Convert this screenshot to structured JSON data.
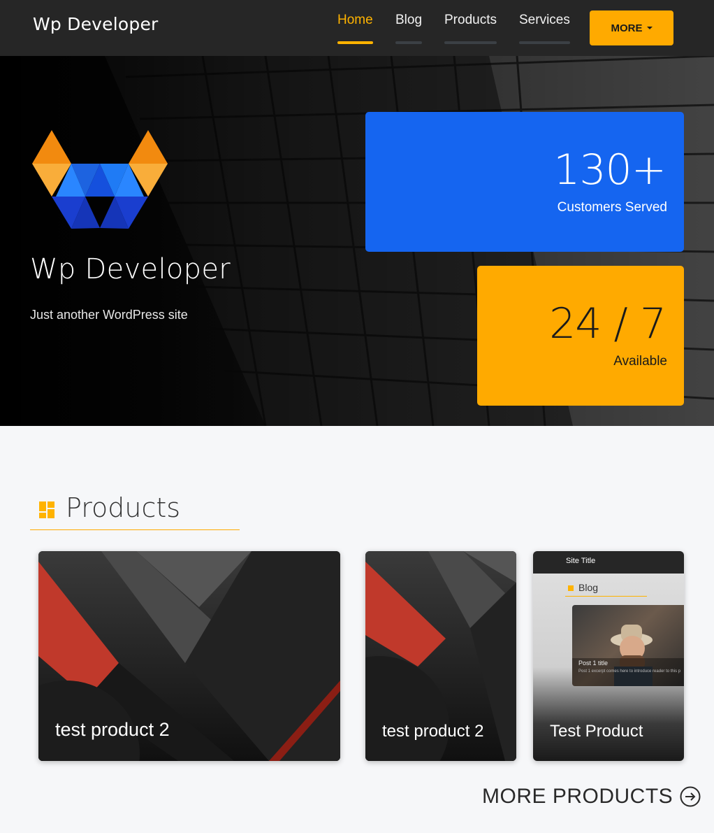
{
  "navbar": {
    "brand": "Wp Developer",
    "items": [
      {
        "label": "Home",
        "active": true
      },
      {
        "label": "Blog",
        "active": false
      },
      {
        "label": "Products",
        "active": false
      },
      {
        "label": "Services",
        "active": false
      }
    ],
    "more_label": "MORE"
  },
  "hero": {
    "title": "Wp Developer",
    "subtitle": "Just another WordPress site",
    "stats": [
      {
        "value": "130+",
        "label": "Customers Served"
      },
      {
        "value": "24 / 7",
        "label": "Available"
      }
    ]
  },
  "products": {
    "title": "Products",
    "items": [
      {
        "title": "test product 2"
      },
      {
        "title": "test product 2"
      },
      {
        "title": "Test Product",
        "preview": {
          "site_title": "Site Title",
          "section": "Blog",
          "post_title": "Post 1 title",
          "post_excerpt": "Post 1 excerpt comes here to introduce reader to this p"
        }
      }
    ],
    "more_label": "MORE PRODUCTS"
  },
  "colors": {
    "accent_yellow": "#ffaa00",
    "primary_blue": "#1565f0",
    "navbar_bg": "#262626",
    "page_bg": "#f6f7f9"
  }
}
